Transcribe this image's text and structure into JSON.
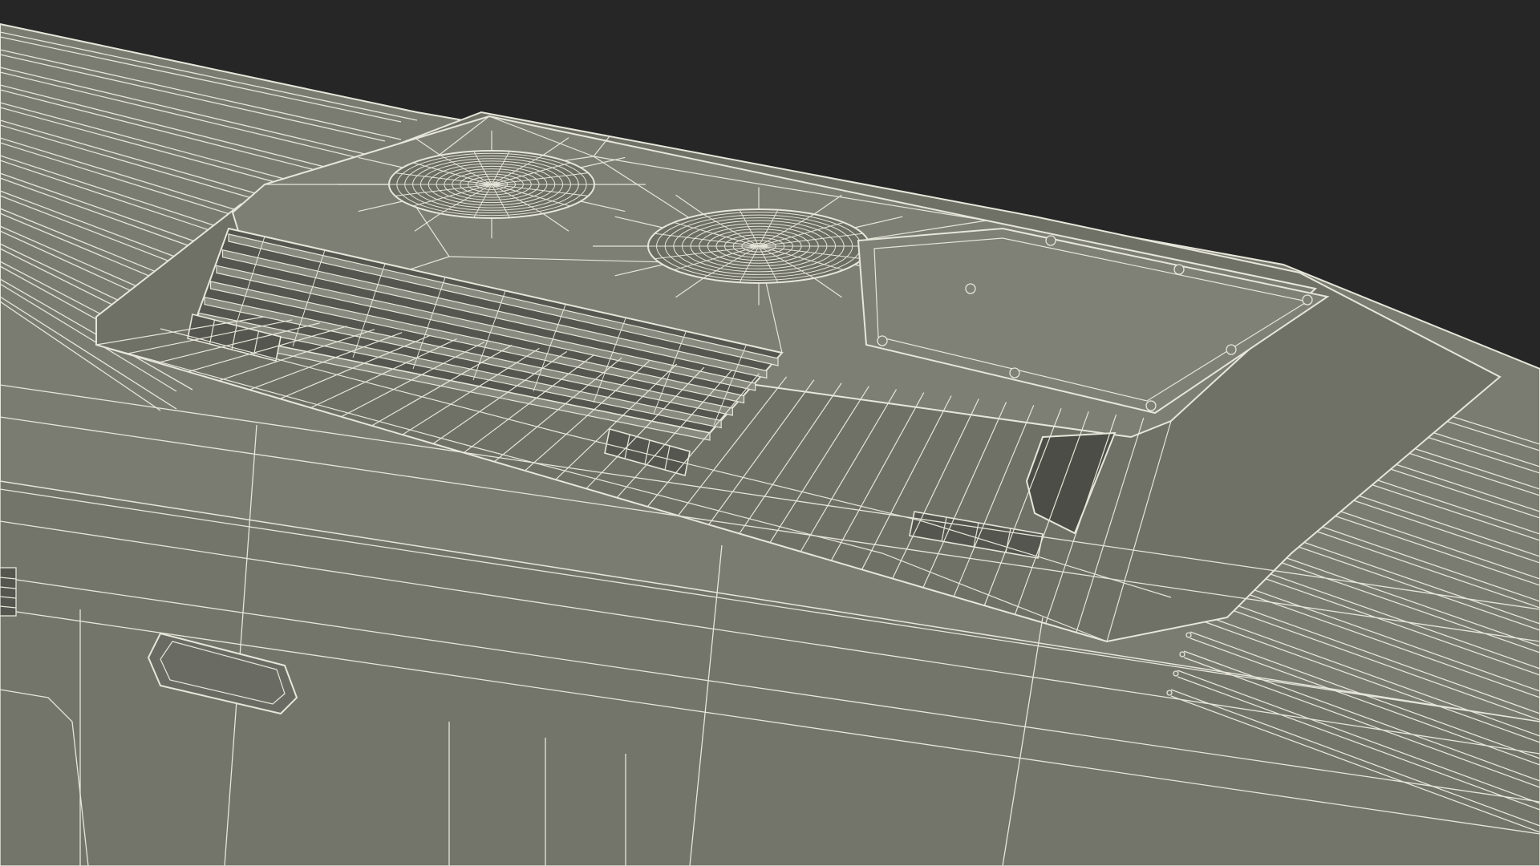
{
  "scene": {
    "kind": "wireframe-render",
    "subject": "locomotive-roof-with-fans",
    "visible_text": []
  },
  "colors": {
    "background": "#262626",
    "surface_top": "#7d7e74",
    "surface_mid": "#75766c",
    "surface_dark": "#6c6d63",
    "shadow": "#4a4b44",
    "wire": "#e6e6da"
  },
  "features": {
    "fan_count": 2,
    "grille_slat_count": 7,
    "vent_count": 3,
    "roof_stripe_count_left": 16,
    "roof_stripe_count_right": 18
  }
}
